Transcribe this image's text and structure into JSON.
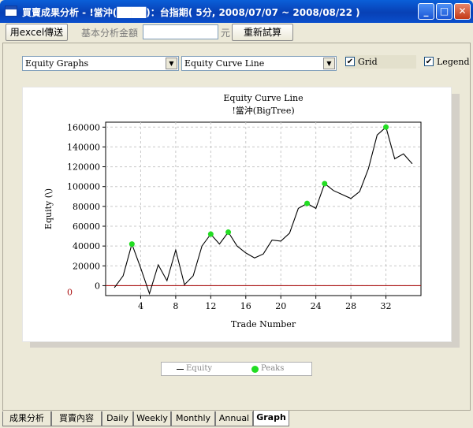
{
  "window": {
    "title": "買賣成果分析 - !當沖(████)：台指期( 5分, 2008/07/07 ~ 2008/08/22 )",
    "minimize": "_",
    "maximize": "□",
    "close": "✕"
  },
  "toolbar": {
    "export_label": "用excel傳送",
    "amount_label": "基本分析金額",
    "amount_value": "",
    "unit": "元",
    "rerun_label": "重新試算"
  },
  "controls": {
    "graph_type": "Equity Graphs",
    "curve_type": "Equity Curve Line",
    "grid_label": "Grid",
    "grid_checked": true,
    "legend_label": "Legend",
    "legend_checked": true,
    "check_mark": "✔",
    "dropdown_arrow": "▼"
  },
  "chart_data": {
    "type": "line",
    "title": "Equity Curve Line",
    "subtitle": "!當沖(BigTree)",
    "xlabel": "Trade Number",
    "ylabel": "Equity (\\)",
    "xlim": [
      0,
      36
    ],
    "ylim": [
      -10000,
      165000
    ],
    "x_ticks": [
      4,
      8,
      12,
      16,
      20,
      24,
      28,
      32
    ],
    "y_ticks": [
      0,
      20000,
      40000,
      60000,
      80000,
      100000,
      120000,
      140000,
      160000
    ],
    "y_tick_labels": [
      "0",
      "20000",
      "40000",
      "60000",
      "80000",
      "100000",
      "120000",
      "140000",
      "160000"
    ],
    "zero_label": "0",
    "grid": true,
    "legend_position": "bottom",
    "series": [
      {
        "name": "Equity",
        "color": "#000000",
        "x": [
          1,
          2,
          3,
          4,
          5,
          6,
          7,
          8,
          9,
          10,
          11,
          12,
          13,
          14,
          15,
          16,
          17,
          18,
          19,
          20,
          21,
          22,
          23,
          24,
          25,
          26,
          27,
          28,
          29,
          30,
          31,
          32,
          33,
          34,
          35
        ],
        "y": [
          -2000,
          10000,
          42000,
          18000,
          -8000,
          21000,
          5000,
          36000,
          1000,
          10000,
          40000,
          52000,
          42000,
          54000,
          40000,
          33000,
          28000,
          32000,
          46000,
          45000,
          53000,
          78000,
          83000,
          78000,
          103000,
          96000,
          92000,
          88000,
          95000,
          118000,
          152000,
          160000,
          128000,
          133000,
          123000
        ]
      },
      {
        "name": "Peaks",
        "color": "#22dd22",
        "x": [
          3,
          12,
          14,
          23,
          25,
          32
        ],
        "y": [
          42000,
          52000,
          54000,
          83000,
          103000,
          160000
        ]
      }
    ],
    "baseline_color": "#aa1111"
  },
  "legend": {
    "equity": "Equity",
    "peaks": "Peaks"
  },
  "tabs": [
    {
      "label": "成果分析",
      "active": false
    },
    {
      "label": "買賣內容",
      "active": false
    },
    {
      "label": "Daily",
      "active": false
    },
    {
      "label": "Weekly",
      "active": false
    },
    {
      "label": "Monthly",
      "active": false
    },
    {
      "label": "Annual",
      "active": false
    },
    {
      "label": "Graph",
      "active": true
    }
  ]
}
